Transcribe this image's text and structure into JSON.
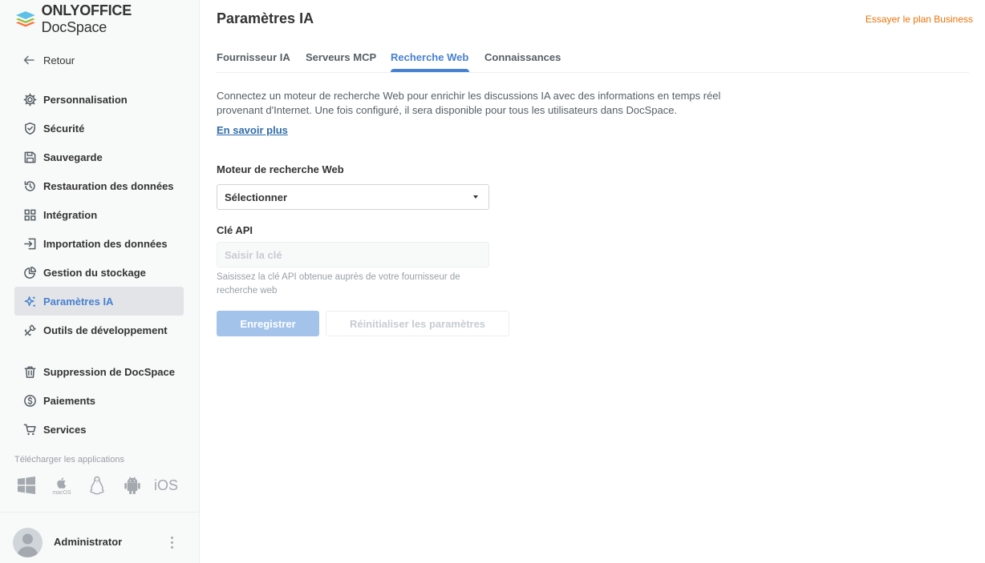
{
  "brand": {
    "name_bold": "ONLYOFFICE",
    "name_regular": " DocSpace"
  },
  "sidebar": {
    "back_label": "Retour",
    "items": [
      {
        "label": "Personnalisation",
        "icon": "gear-icon"
      },
      {
        "label": "Sécurité",
        "icon": "shield-icon"
      },
      {
        "label": "Sauvegarde",
        "icon": "floppy-disk-icon"
      },
      {
        "label": "Restauration des données",
        "icon": "restore-icon"
      },
      {
        "label": "Intégration",
        "icon": "grid-icon"
      },
      {
        "label": "Importation des données",
        "icon": "import-icon"
      },
      {
        "label": "Gestion du stockage",
        "icon": "pie-chart-icon"
      },
      {
        "label": "Paramètres IA",
        "icon": "ai-sparkle-icon",
        "active": true
      },
      {
        "label": "Outils de développement",
        "icon": "developer-tools-icon"
      },
      {
        "label": "Suppression de DocSpace",
        "icon": "trash-icon"
      },
      {
        "label": "Paiements",
        "icon": "dollar-icon"
      },
      {
        "label": "Services",
        "icon": "cart-icon"
      }
    ],
    "download_title": "Télécharger les applications",
    "apps": {
      "windows": "windows-icon",
      "macos_caption": "macOS",
      "linux": "linux-icon",
      "android": "android-icon",
      "ios": "iOS"
    }
  },
  "profile": {
    "name": "Administrator"
  },
  "header": {
    "title": "Paramètres IA",
    "upgrade_link": "Essayer le plan Business"
  },
  "tabs": [
    {
      "label": "Fournisseur IA"
    },
    {
      "label": "Serveurs MCP"
    },
    {
      "label": "Recherche Web",
      "active": true
    },
    {
      "label": "Connaissances"
    }
  ],
  "content": {
    "description_line1": "Connectez un moteur de recherche Web pour enrichir les discussions IA avec des informations en temps réel",
    "description_line2": "provenant d'Internet. Une fois configuré, il sera disponible pour tous les utilisateurs dans DocSpace.",
    "learn_more": "En savoir plus",
    "engine_label": "Moteur de recherche Web",
    "engine_value": "Sélectionner",
    "api_label": "Clé API",
    "api_placeholder": "Saisir la clé",
    "api_hint": "Saisissez la clé API obtenue auprès de votre fournisseur de recherche web",
    "save_button": "Enregistrer",
    "reset_button": "Réinitialiser les paramètres"
  },
  "colors": {
    "accent": "#4781d1",
    "upgrade": "#ed7309",
    "save_disabled": "#a3c3eb"
  }
}
